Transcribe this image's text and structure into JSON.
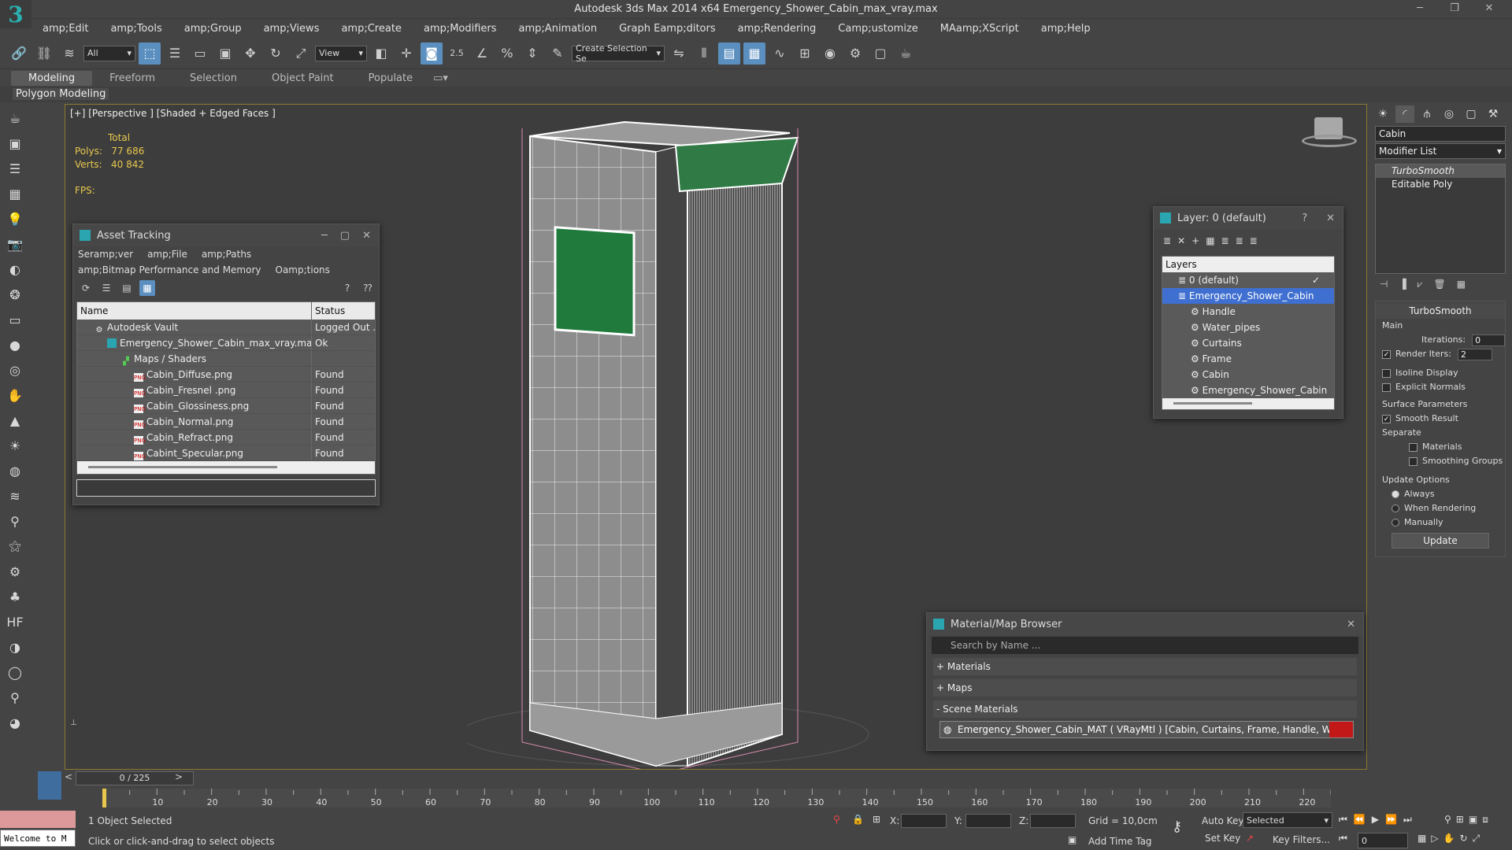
{
  "window": {
    "title": "Autodesk 3ds Max  2014 x64     Emergency_Shower_Cabin_max_vray.max"
  },
  "menu": [
    "amp;Edit",
    "amp;Tools",
    "amp;Group",
    "amp;Views",
    "amp;Create",
    "amp;Modifiers",
    "amp;Animation",
    "Graph Eamp;ditors",
    "amp;Rendering",
    "Camp;ustomize",
    "MAamp;XScript",
    "amp;Help"
  ],
  "toolbar": {
    "selection_filter": "All",
    "ref_coord": "View",
    "angle_snap": "2.5",
    "named_selection": "Create Selection Se"
  },
  "ribbon": {
    "tabs": [
      "Modeling",
      "Freeform",
      "Selection",
      "Object Paint",
      "Populate"
    ],
    "sub": "Polygon Modeling"
  },
  "viewport": {
    "label": "[+] [Perspective ] [Shaded + Edged Faces ]",
    "stats_total": "Total",
    "polys_label": "Polys:",
    "polys_value": "77 686",
    "verts_label": "Verts:",
    "verts_value": "40 842",
    "fps_label": "FPS:"
  },
  "asset_tracking": {
    "title": "Asset Tracking",
    "menu1": [
      "Seramp;ver",
      "amp;File",
      "amp;Paths"
    ],
    "menu2": [
      "amp;Bitmap Performance and Memory",
      "Oamp;tions"
    ],
    "col_name": "Name",
    "col_status": "Status",
    "rows": [
      {
        "name": "Autodesk Vault",
        "status": "Logged Out ..."
      },
      {
        "name": "Emergency_Shower_Cabin_max_vray.max",
        "status": "Ok"
      },
      {
        "name": "Maps / Shaders",
        "status": ""
      },
      {
        "name": "Cabin_Diffuse.png",
        "status": "Found"
      },
      {
        "name": "Cabin_Fresnel .png",
        "status": "Found"
      },
      {
        "name": "Cabin_Glossiness.png",
        "status": "Found"
      },
      {
        "name": "Cabin_Normal.png",
        "status": "Found"
      },
      {
        "name": "Cabin_Refract.png",
        "status": "Found"
      },
      {
        "name": "Cabint_Specular.png",
        "status": "Found"
      }
    ]
  },
  "layer_panel": {
    "title": "Layer: 0 (default)",
    "help": "?",
    "header": "Layers",
    "items": [
      "0 (default)",
      "Emergency_Shower_Cabin",
      "Handle",
      "Water_pipes",
      "Curtains",
      "Frame",
      "Cabin",
      "Emergency_Shower_Cabin"
    ]
  },
  "material_browser": {
    "title": "Material/Map Browser",
    "search_placeholder": "Search by Name ...",
    "sections": [
      "+ Materials",
      "+ Maps",
      "- Scene Materials"
    ],
    "scene_item": "Emergency_Shower_Cabin_MAT  ( VRayMtl )  [Cabin, Curtains, Frame, Handle, Water_pipes]",
    "item_color": "#c21818"
  },
  "command_panel": {
    "object_name": "Cabin",
    "modifier_list": "Modifier List",
    "stack": [
      "TurboSmooth",
      "Editable Poly"
    ],
    "rollout_title": "TurboSmooth",
    "main": "Main",
    "iterations_label": "Iterations:",
    "iterations_value": "0",
    "render_iters_label": "Render Iters:",
    "render_iters_value": "2",
    "isoline": "Isoline Display",
    "explicit": "Explicit Normals",
    "surface": "Surface Parameters",
    "smooth_result": "Smooth Result",
    "separate": "Separate",
    "materials": "Materials",
    "smoothing_groups": "Smoothing Groups",
    "update_options": "Update Options",
    "always": "Always",
    "when_rendering": "When Rendering",
    "manually": "Manually",
    "update_btn": "Update"
  },
  "timeline": {
    "frame": "0 / 225",
    "ticks": [
      "10",
      "20",
      "30",
      "40",
      "50",
      "60",
      "70",
      "80",
      "90",
      "100",
      "110",
      "120",
      "130",
      "140",
      "150",
      "160",
      "170",
      "180",
      "190",
      "200",
      "210",
      "220"
    ]
  },
  "status": {
    "selected": "1 Object Selected",
    "prompt": "Click or click-and-drag to select objects",
    "welcome": "Welcome to M",
    "x": "X:",
    "y": "Y:",
    "z": "Z:",
    "grid": "Grid = 10,0cm",
    "add_time_tag": "Add Time Tag",
    "auto_key": "Auto Key",
    "auto_key_mode": "Selected",
    "set_key": "Set Key",
    "key_filters": "Key Filters...",
    "frame_field": "0"
  }
}
